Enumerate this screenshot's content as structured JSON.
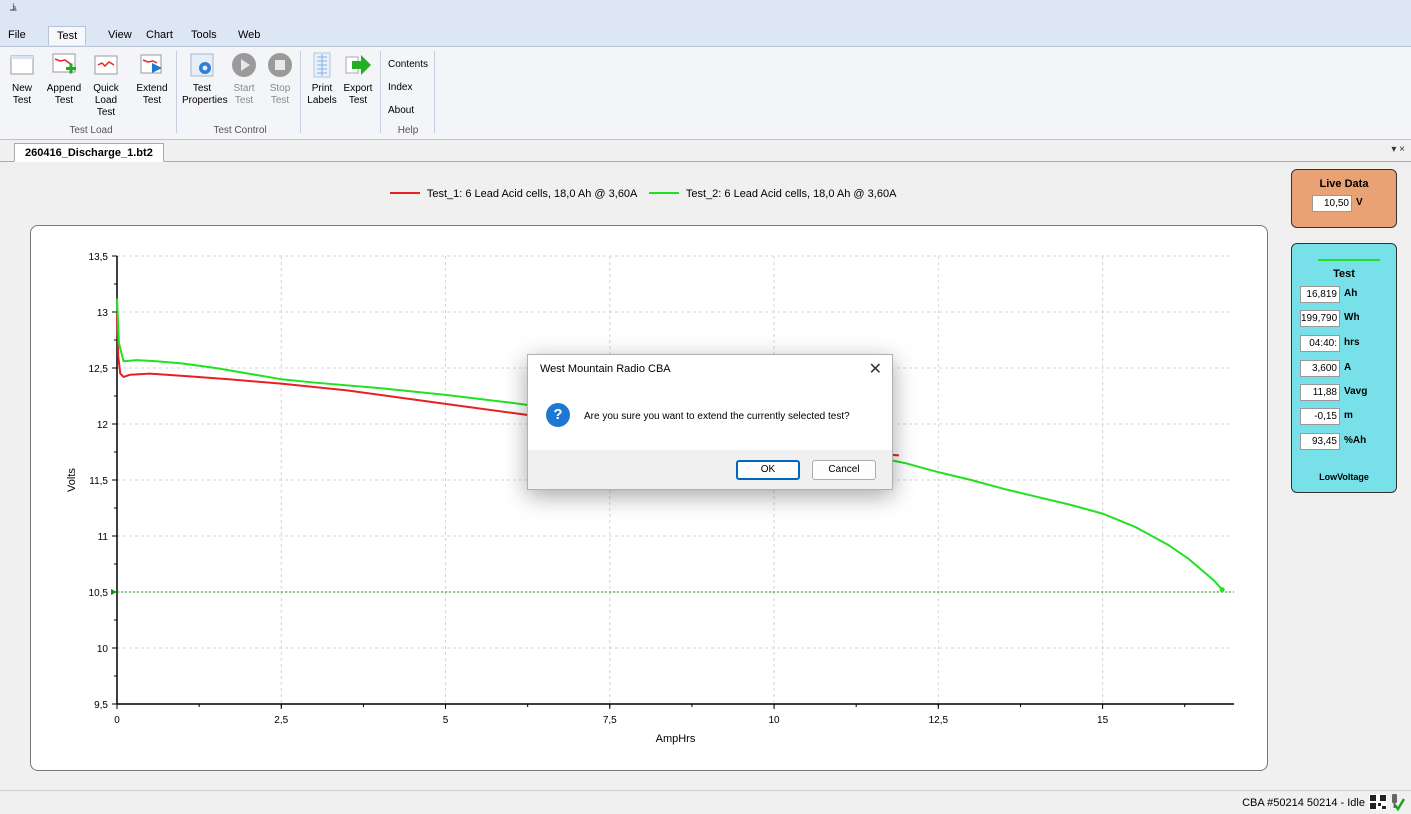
{
  "menubar": {
    "items": [
      "File",
      "Test",
      "View",
      "Chart",
      "Tools",
      "Web"
    ],
    "active": "Test"
  },
  "ribbon": {
    "test_load": {
      "label": "Test Load",
      "buttons": [
        {
          "line1": "New",
          "line2": "Test",
          "icon": "new-test-icon"
        },
        {
          "line1": "Append",
          "line2": "Test",
          "icon": "append-test-icon"
        },
        {
          "line1": "Quick",
          "line2": "Load Test",
          "icon": "quick-load-icon"
        },
        {
          "line1": "Extend",
          "line2": "Test",
          "icon": "extend-test-icon"
        }
      ]
    },
    "test_control": {
      "label": "Test Control",
      "buttons": [
        {
          "line1": "Test",
          "line2": "Properties",
          "icon": "gear-icon"
        },
        {
          "line1": "Start",
          "line2": "Test",
          "icon": "play-icon"
        },
        {
          "line1": "Stop",
          "line2": "Test",
          "icon": "stop-icon"
        }
      ]
    },
    "output": {
      "buttons": [
        {
          "line1": "Print",
          "line2": "Labels",
          "icon": "print-labels-icon"
        },
        {
          "line1": "Export",
          "line2": "Test",
          "icon": "export-arrow-icon"
        }
      ]
    },
    "help": {
      "label": "Help",
      "items": [
        "Contents",
        "Index",
        "About"
      ]
    }
  },
  "doc_tab": {
    "title": "260416_Discharge_1.bt2",
    "controls": "▾ ×"
  },
  "chart_data": {
    "type": "line",
    "xlabel": "AmpHrs",
    "ylabel": "Volts",
    "xlim": [
      0,
      17
    ],
    "ylim": [
      9.5,
      13.5
    ],
    "xticks": [
      "0",
      "2,5",
      "5",
      "7,5",
      "10",
      "12,5",
      "15"
    ],
    "xtick_values": [
      0,
      2.5,
      5,
      7.5,
      10,
      12.5,
      15
    ],
    "yticks": [
      "9,5",
      "10",
      "10,5",
      "11",
      "11,5",
      "12",
      "12,5",
      "13",
      "13,5"
    ],
    "ytick_values": [
      9.5,
      10,
      10.5,
      11,
      11.5,
      12,
      12.5,
      13,
      13.5
    ],
    "grid": true,
    "legend_position": "top",
    "threshold": {
      "y": 10.5,
      "color": "#1e8c1e"
    },
    "series": [
      {
        "name": "Test_1: 6 Lead Acid cells, 18,0 Ah @ 3,60A",
        "color": "#e82020",
        "x": [
          0,
          0.02,
          0.05,
          0.1,
          0.2,
          0.5,
          1.0,
          1.7,
          2.5,
          3.5,
          4.5,
          5.0,
          6.0,
          7.0,
          8.0,
          9.0,
          10.0,
          11.0,
          11.9
        ],
        "y": [
          12.98,
          12.6,
          12.45,
          12.42,
          12.44,
          12.45,
          12.43,
          12.4,
          12.36,
          12.3,
          12.22,
          12.18,
          12.1,
          12.02,
          11.95,
          11.88,
          11.81,
          11.75,
          11.72
        ]
      },
      {
        "name": "Test_2: 6 Lead Acid cells, 18,0 Ah @ 3,60A",
        "color": "#22e022",
        "x": [
          0,
          0.03,
          0.1,
          0.3,
          0.6,
          1.0,
          1.5,
          2.0,
          2.5,
          3.0,
          4.0,
          5.0,
          6.0,
          7.0,
          8.0,
          9.0,
          10.0,
          11.0,
          12.0,
          12.5,
          13.0,
          13.5,
          14.0,
          14.5,
          15.0,
          15.5,
          16.0,
          16.3,
          16.5,
          16.7,
          16.82
        ],
        "y": [
          13.12,
          12.72,
          12.56,
          12.57,
          12.56,
          12.54,
          12.5,
          12.45,
          12.4,
          12.37,
          12.32,
          12.26,
          12.19,
          12.11,
          12.03,
          11.95,
          11.86,
          11.77,
          11.65,
          11.57,
          11.5,
          11.42,
          11.35,
          11.28,
          11.2,
          11.08,
          10.92,
          10.8,
          10.7,
          10.6,
          10.52
        ]
      }
    ]
  },
  "live_data": {
    "title": "Live Data",
    "value": "10,50",
    "unit": "V"
  },
  "test_panel": {
    "title": "Test",
    "line_color": "#22e022",
    "rows": [
      {
        "value": "16,819",
        "unit": "Ah"
      },
      {
        "value": "199,790",
        "unit": "Wh"
      },
      {
        "value": "04:40:",
        "unit": "hrs"
      },
      {
        "value": "3,600",
        "unit": "A"
      },
      {
        "value": "11,88",
        "unit": "Vavg"
      },
      {
        "value": "-0,15",
        "unit": "m"
      },
      {
        "value": "93,45",
        "unit": "%Ah"
      }
    ],
    "status": "LowVoltage"
  },
  "dialog": {
    "title": "West Mountain Radio CBA",
    "message": "Are you sure you want to extend the currently selected test?",
    "ok": "OK",
    "cancel": "Cancel"
  },
  "statusbar": {
    "text": "CBA #50214 50214 - Idle"
  }
}
